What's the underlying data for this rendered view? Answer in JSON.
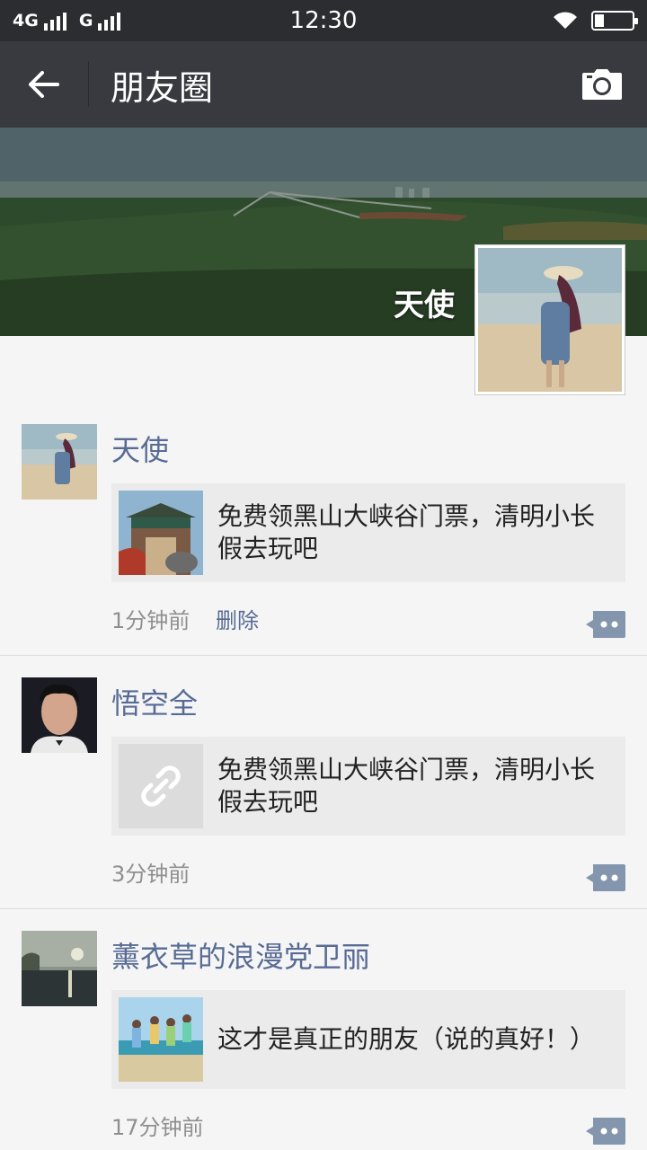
{
  "status": {
    "net1": "4G",
    "net2": "G",
    "time": "12:30"
  },
  "nav": {
    "title": "朋友圈"
  },
  "cover": {
    "name": "天使"
  },
  "posts": [
    {
      "name": "天使",
      "link_text": "免费领黑山大峡谷门票，清明小长假去玩吧",
      "time": "1分钟前",
      "delete_label": "删除"
    },
    {
      "name": "悟空全",
      "link_text": "免费领黑山大峡谷门票，清明小长假去玩吧",
      "time": "3分钟前"
    },
    {
      "name": "薰衣草的浪漫党卫丽",
      "link_text": "这才是真正的朋友（说的真好！）",
      "time": "17分钟前"
    }
  ],
  "colors": {
    "nav_bg": "#393a3f",
    "status_bg": "#2b2d30",
    "name_link": "#576b95",
    "card_bg": "#ebebeb"
  },
  "icons": [
    "back-arrow-icon",
    "camera-icon",
    "link-icon",
    "comment-icon",
    "wifi-icon",
    "battery-icon"
  ]
}
